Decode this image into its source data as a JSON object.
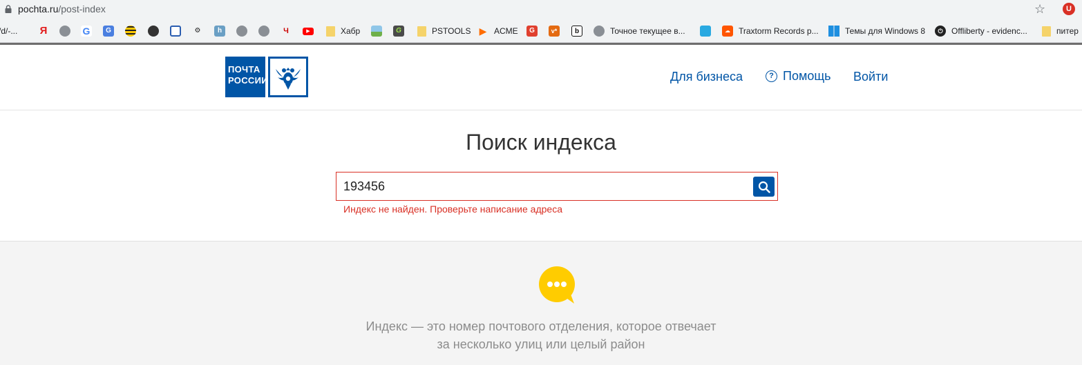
{
  "browser": {
    "url_host": "pochta.ru",
    "url_path": "/post-index",
    "bookmarks": [
      {
        "label": "/d/-...",
        "icon": "bookmark-partial-icon"
      },
      {
        "label": "",
        "icon": "yandex-icon"
      },
      {
        "label": "",
        "icon": "globe-icon"
      },
      {
        "label": "",
        "icon": "google-icon"
      },
      {
        "label": "",
        "icon": "google-translate-icon"
      },
      {
        "label": "",
        "icon": "beeline-icon"
      },
      {
        "label": "",
        "icon": "site-icon"
      },
      {
        "label": "",
        "icon": "site-icon"
      },
      {
        "label": "",
        "icon": "site-icon"
      },
      {
        "label": "",
        "icon": "hh-icon"
      },
      {
        "label": "",
        "icon": "globe-icon"
      },
      {
        "label": "",
        "icon": "globe-icon"
      },
      {
        "label": "",
        "icon": "site-icon"
      },
      {
        "label": "",
        "icon": "youtube-icon"
      },
      {
        "label": "Хабр",
        "icon": "folder-icon"
      },
      {
        "label": "",
        "icon": "site-icon"
      },
      {
        "label": "",
        "icon": "site-icon"
      },
      {
        "label": "PSTOOLS",
        "icon": "folder-icon"
      },
      {
        "label": "ACME",
        "icon": "play-icon"
      },
      {
        "label": "",
        "icon": "site-icon"
      },
      {
        "label": "",
        "icon": "site-icon"
      },
      {
        "label": "",
        "icon": "site-icon"
      },
      {
        "label": "Точное текущее в...",
        "icon": "globe-icon"
      },
      {
        "label": "",
        "icon": "site-icon"
      },
      {
        "label": "Traxtorm Records p...",
        "icon": "soundcloud-icon"
      },
      {
        "label": "Темы для Windows 8",
        "icon": "windows-icon"
      },
      {
        "label": "Offliberty - evidenc...",
        "icon": "power-icon"
      },
      {
        "label": "питер",
        "icon": "folder-icon"
      }
    ]
  },
  "header": {
    "logo_line1": "ПОЧТА",
    "logo_line2": "РОССИИ",
    "nav_business": "Для бизнеса",
    "nav_help": "Помощь",
    "nav_login": "Войти",
    "brand_color": "#0055a6"
  },
  "search": {
    "title": "Поиск индекса",
    "value": "193456",
    "error": "Индекс не найден. Проверьте написание адреса",
    "error_color": "#d93025"
  },
  "info": {
    "line1": "Индекс — это номер почтового отделения, которое отвечает",
    "line2": "за несколько улиц или целый район",
    "bubble_color": "#ffcc00"
  }
}
